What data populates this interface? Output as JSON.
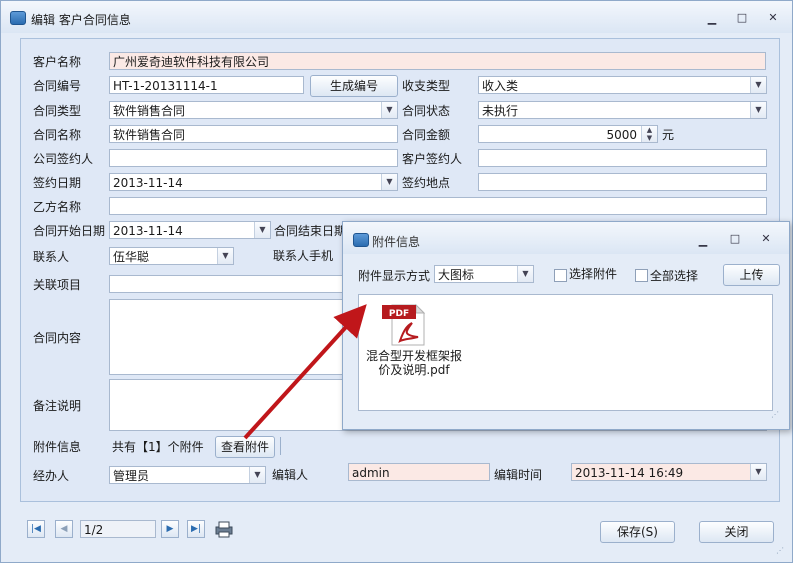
{
  "window": {
    "title": "编辑 客户合同信息",
    "minimize": "▁",
    "restore": "□",
    "close": "✕"
  },
  "form": {
    "customer_name_label": "客户名称",
    "customer_name": "广州爱奇迪软件科技有限公司",
    "contract_no_label": "合同编号",
    "contract_no": "HT-1-20131114-1",
    "generate_button": "生成编号",
    "income_type_label": "收支类型",
    "income_type": "收入类",
    "contract_type_label": "合同类型",
    "contract_type": "软件销售合同",
    "contract_status_label": "合同状态",
    "contract_status": "未执行",
    "contract_name_label": "合同名称",
    "contract_name": "软件销售合同",
    "amount_label": "合同金额",
    "amount": "5000",
    "amount_unit": "元",
    "company_signer_label": "公司签约人",
    "company_signer": "",
    "customer_signer_label": "客户签约人",
    "customer_signer": "",
    "sign_date_label": "签约日期",
    "sign_date": "2013-11-14",
    "sign_place_label": "签约地点",
    "sign_place": "",
    "party_b_label": "乙方名称",
    "party_b": "",
    "start_date_label": "合同开始日期",
    "start_date": "2013-11-14",
    "end_date_label": "合同结束日期",
    "contact_label": "联系人",
    "contact": "伍华聪",
    "contact_phone_label": "联系人手机",
    "project_label": "关联项目",
    "content_label": "合同内容",
    "remark_label": "备注说明",
    "attachment_label": "附件信息",
    "attachment_count": "共有【1】个附件",
    "view_attachment_button": "查看附件",
    "handler_label": "经办人",
    "handler": "管理员",
    "editor_label": "编辑人",
    "editor": "admin",
    "edit_time_label": "编辑时间",
    "edit_time": "2013-11-14 16:49"
  },
  "bottom": {
    "page": "1/2",
    "save_button": "保存(S)",
    "close_button": "关闭"
  },
  "popup": {
    "title": "附件信息",
    "display_mode_label": "附件显示方式",
    "display_mode": "大图标",
    "select_attachment": "选择附件",
    "select_all": "全部选择",
    "upload_button": "上传",
    "file": {
      "name": "混合型开发框架报价及说明.pdf",
      "icon_text": "PDF"
    }
  },
  "colors": {
    "readonly_bg": "#fbe9e5",
    "accent": "#2b6cb0",
    "arrow": "#c0161a"
  }
}
